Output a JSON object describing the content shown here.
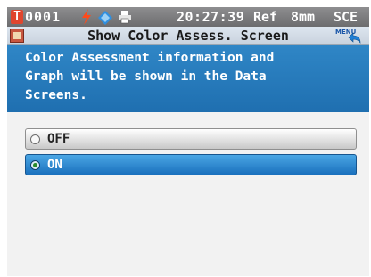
{
  "status_bar": {
    "badge": "T",
    "sample_number": "0001",
    "time": "20:27:39",
    "reference": "Ref",
    "aperture": "8mm",
    "mode": "SCE",
    "icons": [
      "battery-bolt-icon",
      "bluetooth-diamond-icon",
      "printer-icon"
    ]
  },
  "title_bar": {
    "title": "Show Color Assess. Screen",
    "menu_label": "MENU"
  },
  "message": {
    "text": "Color Assessment information and\nGraph will be shown in the Data\nScreens."
  },
  "options": [
    {
      "label": "OFF",
      "selected": false
    },
    {
      "label": "ON",
      "selected": true
    }
  ],
  "colors": {
    "message_bg": "#2f86c6",
    "selected_bg": "#1a70bd",
    "status_bar_bg": "#7a7a7c"
  }
}
